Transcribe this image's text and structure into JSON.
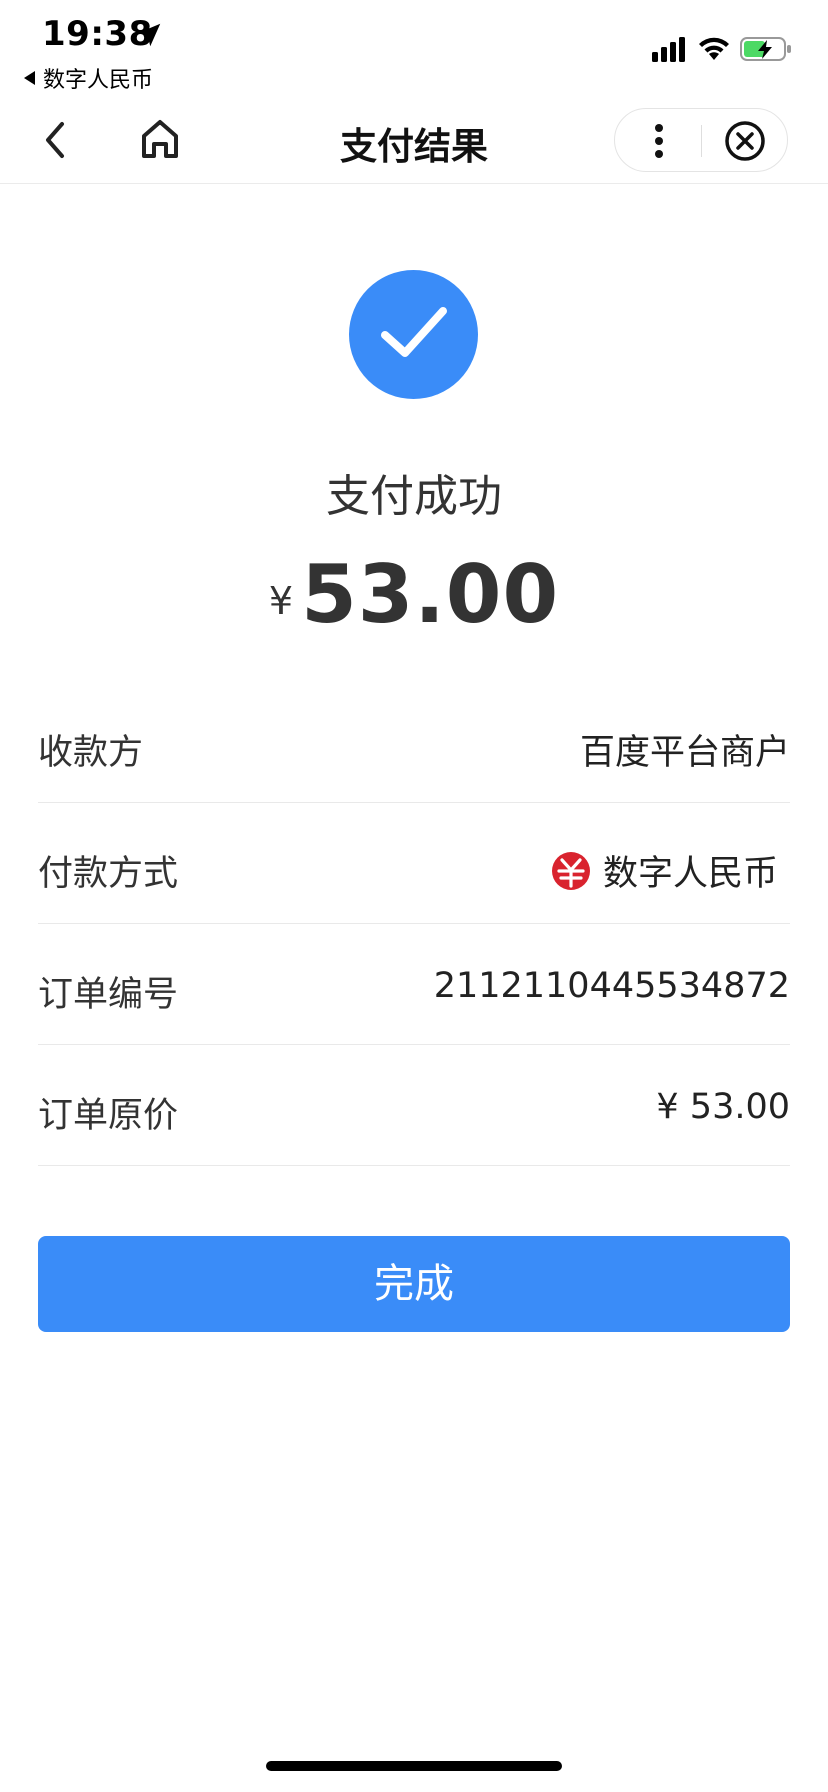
{
  "status_bar": {
    "time": "19:38",
    "back_app": "数字人民币"
  },
  "nav": {
    "title": "支付结果"
  },
  "result": {
    "status": "支付成功",
    "currency": "¥",
    "amount": "53.00"
  },
  "details": [
    {
      "label": "收款方",
      "value": "百度平台商户"
    },
    {
      "label": "付款方式",
      "value": "数字人民币"
    },
    {
      "label": "订单编号",
      "value": "2112110445534872"
    },
    {
      "label": "订单原价",
      "value": "¥ 53.00"
    }
  ],
  "actions": {
    "done_label": "完成"
  },
  "colors": {
    "accent": "#3a8cf8",
    "ecny_red": "#d9232e",
    "battery_green": "#4cd964"
  },
  "icons": [
    "location-arrow-icon",
    "signal-icon",
    "wifi-icon",
    "battery-icon",
    "chevron-left-icon",
    "home-icon",
    "more-icon",
    "close-icon",
    "checkmark-icon",
    "ecny-icon"
  ]
}
